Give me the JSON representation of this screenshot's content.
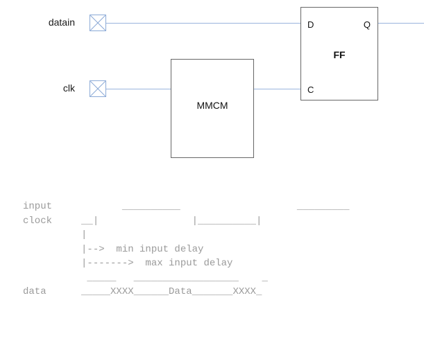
{
  "schematic": {
    "ports": [
      {
        "label": "datain",
        "icon": "input-port-icon"
      },
      {
        "label": "clk",
        "icon": "input-port-icon"
      }
    ],
    "blocks": [
      {
        "name": "MMCM",
        "label": "MMCM"
      },
      {
        "name": "FF",
        "label": "FF"
      }
    ],
    "ff_pins": {
      "d": "D",
      "q": "Q",
      "c": "C"
    },
    "colors": {
      "wire": "#9ab4dd",
      "port_border": "#8aa9d6",
      "block_border": "#666666",
      "label_text": "#1a1a1a",
      "ascii_text": "#9a9a9a"
    }
  },
  "timing": {
    "title": "",
    "lines": [
      "input            __________                    _________",
      "clock     __|                |__________|",
      "          |",
      "          |-->  min input delay",
      "          |------->  max input delay",
      "           _____   __________________    _",
      "data      _____XXXX______Data_______XXXX_"
    ],
    "row_labels": [
      "input",
      "clock",
      "data"
    ],
    "annotations": [
      "min input delay",
      "max input delay"
    ],
    "data_values": [
      "XXXX",
      "Data",
      "XXXX"
    ]
  }
}
